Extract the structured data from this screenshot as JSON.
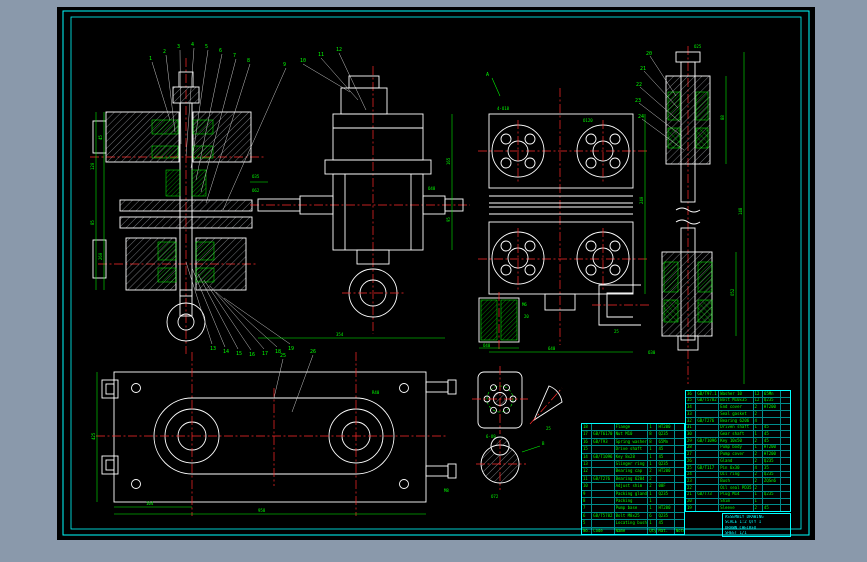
{
  "colors": {
    "bg": "#8a99ab",
    "canvas": "#000000",
    "frame": "#00ffff",
    "line": "#ffffff",
    "dim": "#00ff00",
    "center": "#ff2a2a"
  },
  "callouts": {
    "top": [
      "1",
      "2",
      "3",
      "4",
      "5",
      "6",
      "7",
      "8",
      "9",
      "10",
      "11",
      "12"
    ],
    "bottom": [
      "13",
      "14",
      "15",
      "16",
      "17",
      "18",
      "19"
    ],
    "right": [
      "20",
      "21",
      "22",
      "23",
      "24"
    ],
    "plan": [
      "25",
      "26"
    ]
  },
  "dims": {
    "v1_left": [
      "120",
      "85",
      "260",
      "45"
    ],
    "v1_right": [
      "O35",
      "O62"
    ],
    "v2": [
      "165",
      "95",
      "354",
      "O48"
    ],
    "v3": [
      "640",
      "240",
      "4-O18",
      "O120",
      "25",
      "O40",
      "M6",
      "20",
      "A"
    ],
    "v4": [
      "88",
      "148",
      "O52",
      "O25",
      "O30"
    ],
    "v5": [
      "958",
      "104",
      "425",
      "R40",
      "M8"
    ],
    "v6": [
      "6-O9",
      "O72",
      "25",
      "B"
    ]
  },
  "bom_right": {
    "rows": [
      [
        "36",
        "GB/T97.1",
        "Washer 10",
        "12",
        "65Mn",
        ""
      ],
      [
        "35",
        "GB/T5782",
        "Bolt M10x35",
        "12",
        "Q235",
        ""
      ],
      [
        "34",
        "",
        "End cover",
        "2",
        "HT200",
        ""
      ],
      [
        "33",
        "",
        "Seal gasket",
        "2",
        "",
        ""
      ],
      [
        "32",
        "GB/T276",
        "Bearing 6206",
        "4",
        "",
        ""
      ],
      [
        "31",
        "",
        "Driven shaft",
        "1",
        "45",
        ""
      ],
      [
        "30",
        "",
        "Gear shaft",
        "1",
        "45",
        ""
      ],
      [
        "29",
        "GB/T1096",
        "Key 10x50",
        "2",
        "45",
        ""
      ],
      [
        "28",
        "",
        "Pump body",
        "1",
        "HT200",
        ""
      ],
      [
        "27",
        "",
        "Pump cover",
        "2",
        "HT200",
        ""
      ],
      [
        "26",
        "",
        "Gland",
        "2",
        "Q235",
        ""
      ],
      [
        "25",
        "GB/T117",
        "Pin 6x30",
        "4",
        "35",
        ""
      ],
      [
        "24",
        "",
        "Oil ring",
        "2",
        "Q235",
        ""
      ],
      [
        "23",
        "",
        "Bush",
        "2",
        "ZQSn6",
        ""
      ],
      [
        "22",
        "",
        "Oil seal PD35",
        "2",
        "",
        ""
      ],
      [
        "21",
        "GB/T73",
        "Plug M14",
        "1",
        "Q235",
        ""
      ],
      [
        "20",
        "",
        "Shim",
        "1",
        "",
        ""
      ],
      [
        "19",
        "",
        "Sleeve",
        "2",
        "45",
        ""
      ]
    ]
  },
  "bom_left": {
    "rows": [
      [
        "18",
        "",
        "Flange",
        "1",
        "HT200",
        ""
      ],
      [
        "17",
        "GB/T6170",
        "Nut M10",
        "8",
        "Q235",
        ""
      ],
      [
        "16",
        "GB/T93",
        "Spring washer",
        "8",
        "65Mn",
        ""
      ],
      [
        "15",
        "",
        "Drive shaft",
        "1",
        "45",
        ""
      ],
      [
        "14",
        "GB/T1096",
        "Key 8x28",
        "1",
        "45",
        ""
      ],
      [
        "13",
        "",
        "Slinger ring",
        "1",
        "Q235",
        ""
      ],
      [
        "12",
        "",
        "Bearing cap",
        "2",
        "HT200",
        ""
      ],
      [
        "11",
        "GB/T276",
        "Bearing 6204",
        "2",
        "",
        ""
      ],
      [
        "10",
        "",
        "Adjust shim",
        "2",
        "08F",
        ""
      ],
      [
        "9",
        "",
        "Packing gland",
        "1",
        "Q235",
        ""
      ],
      [
        "8",
        "",
        "Packing",
        "1",
        "",
        ""
      ],
      [
        "7",
        "",
        "Pump base",
        "1",
        "HT200",
        ""
      ],
      [
        "6",
        "GB/T5782",
        "Bolt M8x25",
        "6",
        "Q235",
        ""
      ],
      [
        "5",
        "",
        "Locating bush",
        "1",
        "45",
        ""
      ],
      [
        "No.",
        "Code",
        "Name",
        "Qty",
        "Mat.",
        "Note"
      ]
    ]
  },
  "title_block": {
    "rows": [
      "ASSEMBLY DRAWING",
      "SCALE 1:2   QTY 1",
      "DRAWN      CHECKED",
      "SHEET 1/1"
    ]
  }
}
